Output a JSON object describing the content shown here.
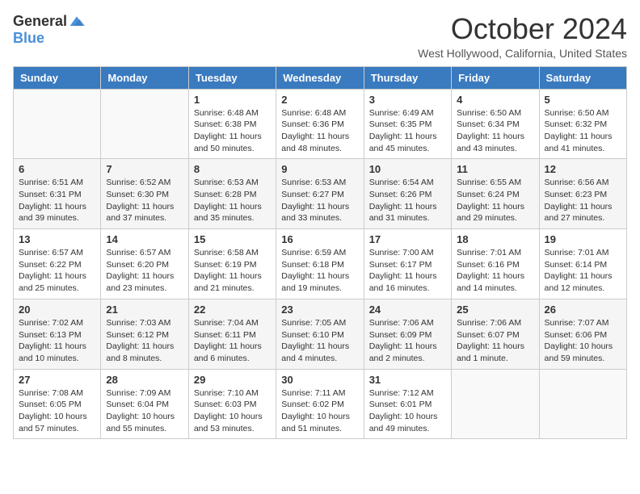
{
  "header": {
    "logo_general": "General",
    "logo_blue": "Blue",
    "title": "October 2024",
    "location": "West Hollywood, California, United States"
  },
  "days_of_week": [
    "Sunday",
    "Monday",
    "Tuesday",
    "Wednesday",
    "Thursday",
    "Friday",
    "Saturday"
  ],
  "weeks": [
    [
      {
        "day": "",
        "sunrise": "",
        "sunset": "",
        "daylight": ""
      },
      {
        "day": "",
        "sunrise": "",
        "sunset": "",
        "daylight": ""
      },
      {
        "day": "1",
        "sunrise": "Sunrise: 6:48 AM",
        "sunset": "Sunset: 6:38 PM",
        "daylight": "Daylight: 11 hours and 50 minutes."
      },
      {
        "day": "2",
        "sunrise": "Sunrise: 6:48 AM",
        "sunset": "Sunset: 6:36 PM",
        "daylight": "Daylight: 11 hours and 48 minutes."
      },
      {
        "day": "3",
        "sunrise": "Sunrise: 6:49 AM",
        "sunset": "Sunset: 6:35 PM",
        "daylight": "Daylight: 11 hours and 45 minutes."
      },
      {
        "day": "4",
        "sunrise": "Sunrise: 6:50 AM",
        "sunset": "Sunset: 6:34 PM",
        "daylight": "Daylight: 11 hours and 43 minutes."
      },
      {
        "day": "5",
        "sunrise": "Sunrise: 6:50 AM",
        "sunset": "Sunset: 6:32 PM",
        "daylight": "Daylight: 11 hours and 41 minutes."
      }
    ],
    [
      {
        "day": "6",
        "sunrise": "Sunrise: 6:51 AM",
        "sunset": "Sunset: 6:31 PM",
        "daylight": "Daylight: 11 hours and 39 minutes."
      },
      {
        "day": "7",
        "sunrise": "Sunrise: 6:52 AM",
        "sunset": "Sunset: 6:30 PM",
        "daylight": "Daylight: 11 hours and 37 minutes."
      },
      {
        "day": "8",
        "sunrise": "Sunrise: 6:53 AM",
        "sunset": "Sunset: 6:28 PM",
        "daylight": "Daylight: 11 hours and 35 minutes."
      },
      {
        "day": "9",
        "sunrise": "Sunrise: 6:53 AM",
        "sunset": "Sunset: 6:27 PM",
        "daylight": "Daylight: 11 hours and 33 minutes."
      },
      {
        "day": "10",
        "sunrise": "Sunrise: 6:54 AM",
        "sunset": "Sunset: 6:26 PM",
        "daylight": "Daylight: 11 hours and 31 minutes."
      },
      {
        "day": "11",
        "sunrise": "Sunrise: 6:55 AM",
        "sunset": "Sunset: 6:24 PM",
        "daylight": "Daylight: 11 hours and 29 minutes."
      },
      {
        "day": "12",
        "sunrise": "Sunrise: 6:56 AM",
        "sunset": "Sunset: 6:23 PM",
        "daylight": "Daylight: 11 hours and 27 minutes."
      }
    ],
    [
      {
        "day": "13",
        "sunrise": "Sunrise: 6:57 AM",
        "sunset": "Sunset: 6:22 PM",
        "daylight": "Daylight: 11 hours and 25 minutes."
      },
      {
        "day": "14",
        "sunrise": "Sunrise: 6:57 AM",
        "sunset": "Sunset: 6:20 PM",
        "daylight": "Daylight: 11 hours and 23 minutes."
      },
      {
        "day": "15",
        "sunrise": "Sunrise: 6:58 AM",
        "sunset": "Sunset: 6:19 PM",
        "daylight": "Daylight: 11 hours and 21 minutes."
      },
      {
        "day": "16",
        "sunrise": "Sunrise: 6:59 AM",
        "sunset": "Sunset: 6:18 PM",
        "daylight": "Daylight: 11 hours and 19 minutes."
      },
      {
        "day": "17",
        "sunrise": "Sunrise: 7:00 AM",
        "sunset": "Sunset: 6:17 PM",
        "daylight": "Daylight: 11 hours and 16 minutes."
      },
      {
        "day": "18",
        "sunrise": "Sunrise: 7:01 AM",
        "sunset": "Sunset: 6:16 PM",
        "daylight": "Daylight: 11 hours and 14 minutes."
      },
      {
        "day": "19",
        "sunrise": "Sunrise: 7:01 AM",
        "sunset": "Sunset: 6:14 PM",
        "daylight": "Daylight: 11 hours and 12 minutes."
      }
    ],
    [
      {
        "day": "20",
        "sunrise": "Sunrise: 7:02 AM",
        "sunset": "Sunset: 6:13 PM",
        "daylight": "Daylight: 11 hours and 10 minutes."
      },
      {
        "day": "21",
        "sunrise": "Sunrise: 7:03 AM",
        "sunset": "Sunset: 6:12 PM",
        "daylight": "Daylight: 11 hours and 8 minutes."
      },
      {
        "day": "22",
        "sunrise": "Sunrise: 7:04 AM",
        "sunset": "Sunset: 6:11 PM",
        "daylight": "Daylight: 11 hours and 6 minutes."
      },
      {
        "day": "23",
        "sunrise": "Sunrise: 7:05 AM",
        "sunset": "Sunset: 6:10 PM",
        "daylight": "Daylight: 11 hours and 4 minutes."
      },
      {
        "day": "24",
        "sunrise": "Sunrise: 7:06 AM",
        "sunset": "Sunset: 6:09 PM",
        "daylight": "Daylight: 11 hours and 2 minutes."
      },
      {
        "day": "25",
        "sunrise": "Sunrise: 7:06 AM",
        "sunset": "Sunset: 6:07 PM",
        "daylight": "Daylight: 11 hours and 1 minute."
      },
      {
        "day": "26",
        "sunrise": "Sunrise: 7:07 AM",
        "sunset": "Sunset: 6:06 PM",
        "daylight": "Daylight: 10 hours and 59 minutes."
      }
    ],
    [
      {
        "day": "27",
        "sunrise": "Sunrise: 7:08 AM",
        "sunset": "Sunset: 6:05 PM",
        "daylight": "Daylight: 10 hours and 57 minutes."
      },
      {
        "day": "28",
        "sunrise": "Sunrise: 7:09 AM",
        "sunset": "Sunset: 6:04 PM",
        "daylight": "Daylight: 10 hours and 55 minutes."
      },
      {
        "day": "29",
        "sunrise": "Sunrise: 7:10 AM",
        "sunset": "Sunset: 6:03 PM",
        "daylight": "Daylight: 10 hours and 53 minutes."
      },
      {
        "day": "30",
        "sunrise": "Sunrise: 7:11 AM",
        "sunset": "Sunset: 6:02 PM",
        "daylight": "Daylight: 10 hours and 51 minutes."
      },
      {
        "day": "31",
        "sunrise": "Sunrise: 7:12 AM",
        "sunset": "Sunset: 6:01 PM",
        "daylight": "Daylight: 10 hours and 49 minutes."
      },
      {
        "day": "",
        "sunrise": "",
        "sunset": "",
        "daylight": ""
      },
      {
        "day": "",
        "sunrise": "",
        "sunset": "",
        "daylight": ""
      }
    ]
  ]
}
